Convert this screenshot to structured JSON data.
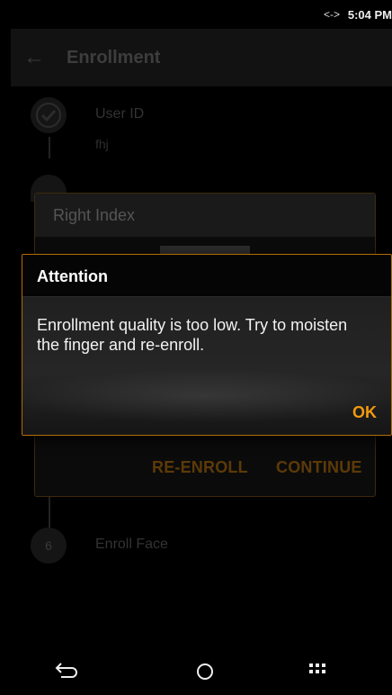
{
  "status_bar": {
    "network_icon": "<->",
    "time": "5:04 PM"
  },
  "app_bar": {
    "back_icon": "back-arrow-icon",
    "title": "Enrollment"
  },
  "stepper": {
    "steps": [
      {
        "label": "User ID",
        "value": "fhj",
        "icon": "check-icon"
      },
      {
        "label": "Enroll Face",
        "number": "6"
      }
    ]
  },
  "card": {
    "title": "Right Index",
    "reenroll_label": "RE-ENROLL",
    "continue_label": "CONTINUE"
  },
  "dialog": {
    "title": "Attention",
    "message": "Enrollment quality is too low. Try to moisten the finger and re-enroll.",
    "ok_label": "OK"
  },
  "colors": {
    "accent": "#f29a0d",
    "accent_dim": "#5d3a08",
    "dialog_border": "#b36d08"
  }
}
